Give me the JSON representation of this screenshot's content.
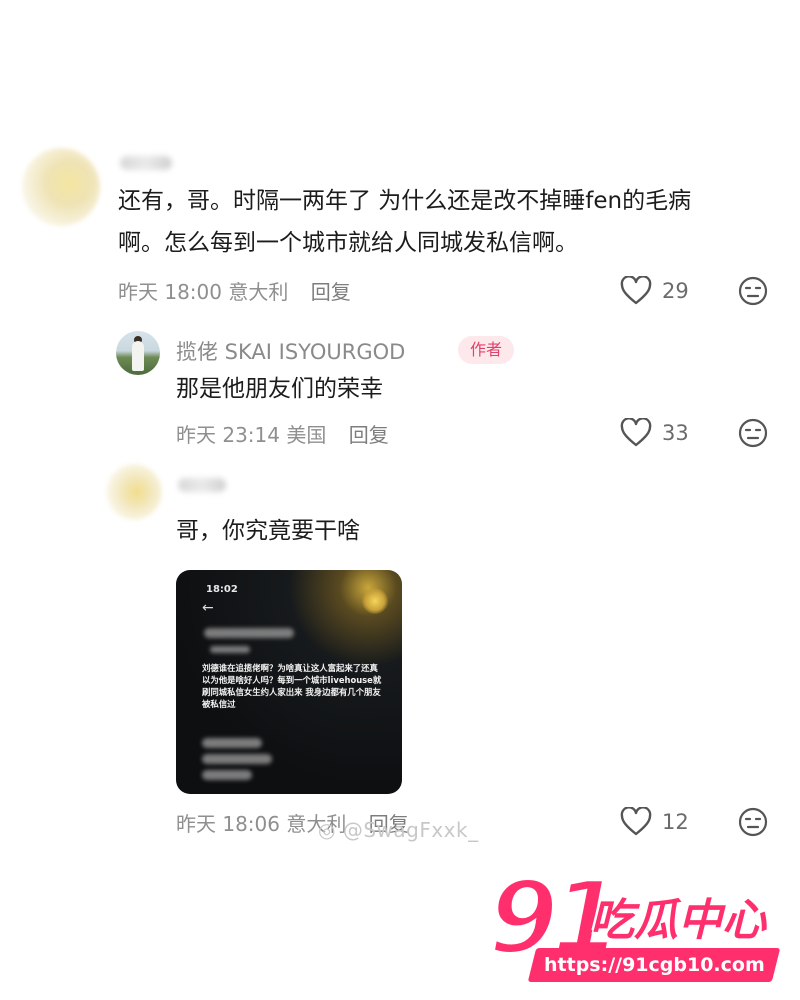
{
  "comments": [
    {
      "text_line1": "还有，哥。时隔一两年了 为什么还是改不掉睡fen的毛病",
      "text_line2": "啊。怎么每到一个城市就给人同城发私信啊。",
      "time": "昨天 18:00",
      "location": "意大利",
      "reply_label": "回复",
      "likes": "29"
    },
    {
      "author": "揽佬 SKAI ISYOURGOD",
      "badge": "作者",
      "text": "那是他朋友们的荣幸",
      "time": "昨天 23:14",
      "location": "美国",
      "reply_label": "回复",
      "likes": "33"
    },
    {
      "text": "哥，你究竟要干啥",
      "time": "昨天 18:06",
      "location": "意大利",
      "reply_label": "回复",
      "likes": "12",
      "attachment": {
        "time": "18:02",
        "message": "刘德谁在追揽佬啊？为啥真让这人富起来了还真以为他是啥好人吗？每到一个城市livehouse就刷同城私信女生约人家出来 我身边都有几个朋友被私信过"
      }
    }
  ],
  "watermark": "@SwagFxxk_",
  "logo": {
    "number": "91",
    "name": "吃瓜中心",
    "url": "https://91cgb10.com",
    "color": "#ff2f6d"
  },
  "icons": {
    "like": "heart-outline-icon",
    "dislike": "meh-face-icon"
  }
}
